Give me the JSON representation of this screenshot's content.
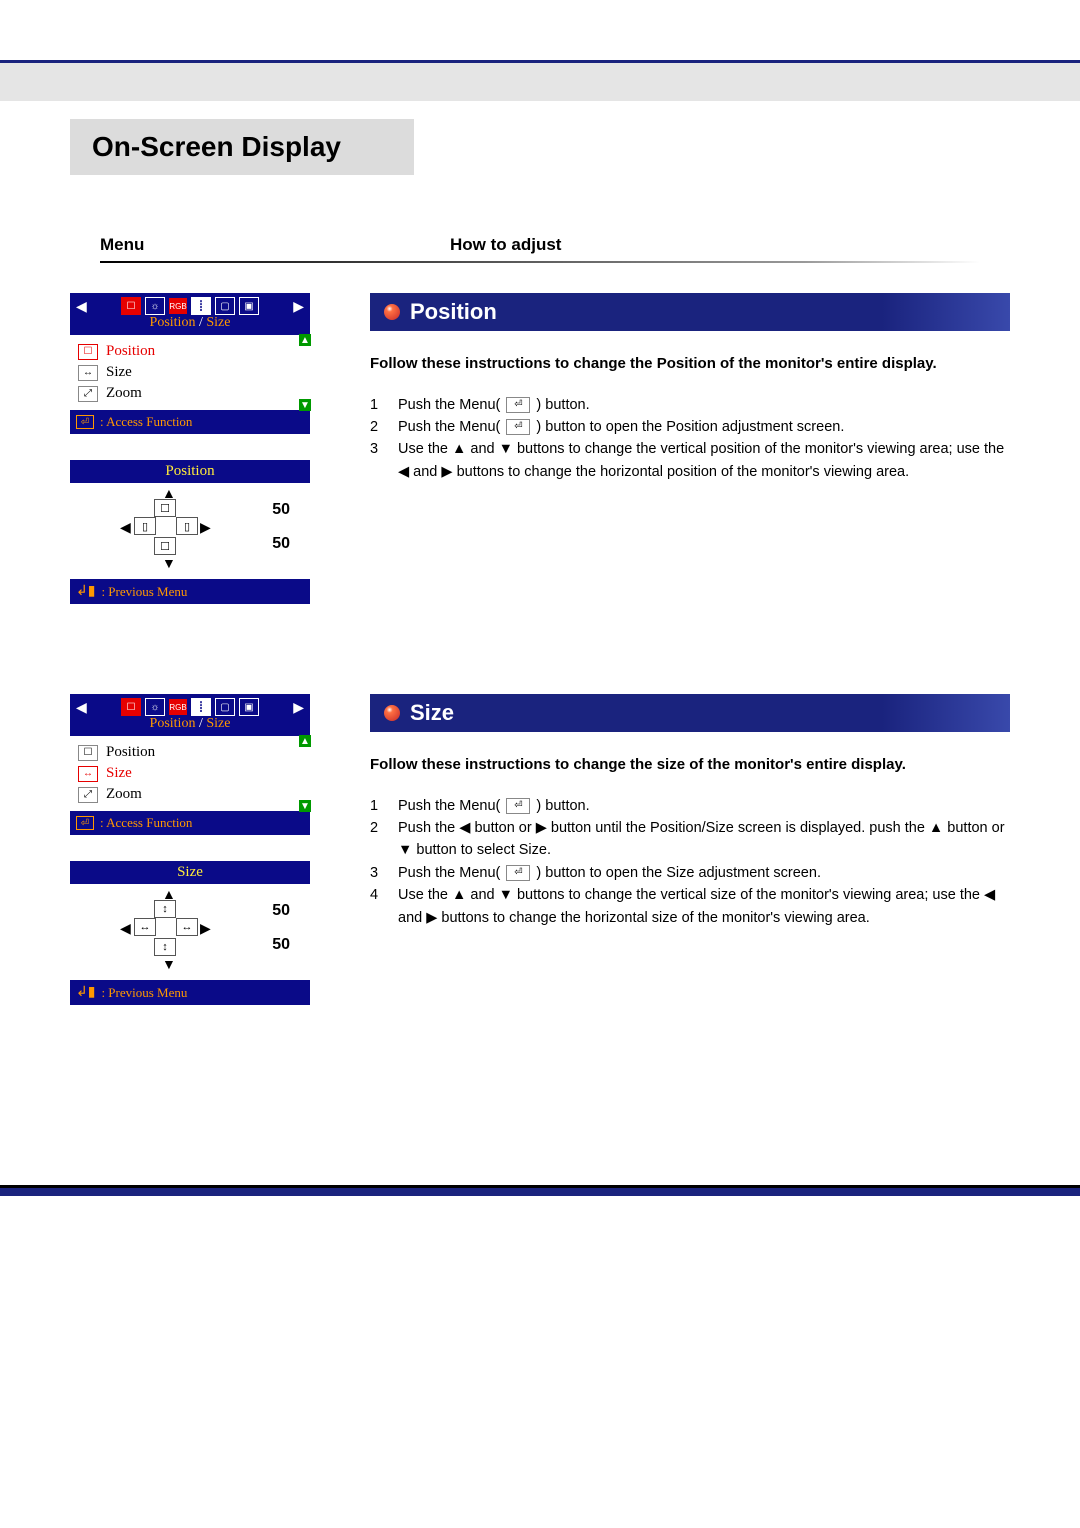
{
  "page_title": "On-Screen Display",
  "headers": {
    "menu": "Menu",
    "howto": "How to adjust"
  },
  "osd": {
    "menu_title_a": "Position",
    "menu_title_sep": " / ",
    "menu_title_b": "Size",
    "items": {
      "position": "Position",
      "size": "Size",
      "zoom": "Zoom"
    },
    "rgb_label": "RGB",
    "footer_access": ": Access Function",
    "footer_prev": ": Previous Menu",
    "adjust": {
      "position_title": "Position",
      "size_title": "Size",
      "val1": "50",
      "val2": "50"
    }
  },
  "sections": {
    "position": {
      "title": "Position",
      "intro": "Follow these instructions to change the Position of the monitor's entire display.",
      "steps": [
        "Push the Menu(  ⏎  ) button.",
        "Push the Menu(  ⏎  ) button to open the Position adjustment screen.",
        "Use the ▲ and ▼ buttons to change the vertical position of the monitor's viewing area; use the ◀ and ▶ buttons to change the horizontal position of the monitor's viewing area."
      ]
    },
    "size": {
      "title": "Size",
      "intro": "Follow these instructions to change the size of the monitor's entire display.",
      "steps": [
        "Push the Menu(  ⏎  ) button.",
        "Push the ◀ button or ▶ button until the Position/Size screen is displayed. push the ▲ button or ▼ button to select Size.",
        "Push the Menu(  ⏎  ) button to open the Size adjustment screen.",
        "Use the ▲ and ▼ buttons to change the vertical size of the monitor's viewing area; use the ◀ and ▶ buttons to change the horizontal size of the monitor's viewing area."
      ]
    }
  }
}
